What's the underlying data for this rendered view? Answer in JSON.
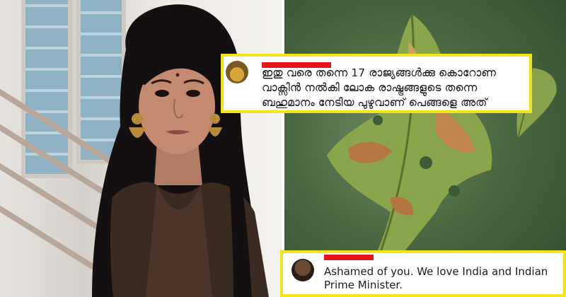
{
  "comments": [
    {
      "text": "ഇതു വരെ തന്നെ 17 രാജ്യങ്ങൾക്കു കൊറോണ വാക്സിൻ നൽകി ലോക രാഷ്ട്രങ്ങളുടെ തന്നെ ബഹുമാനം നേടിയ പുഴുവാണ് പെങ്ങളെ അത്"
    },
    {
      "text": "Ashamed of you. We love India and Indian Prime Minister."
    }
  ],
  "colors": {
    "highlight_border": "#f2e51c",
    "redaction": "#e5161c"
  }
}
